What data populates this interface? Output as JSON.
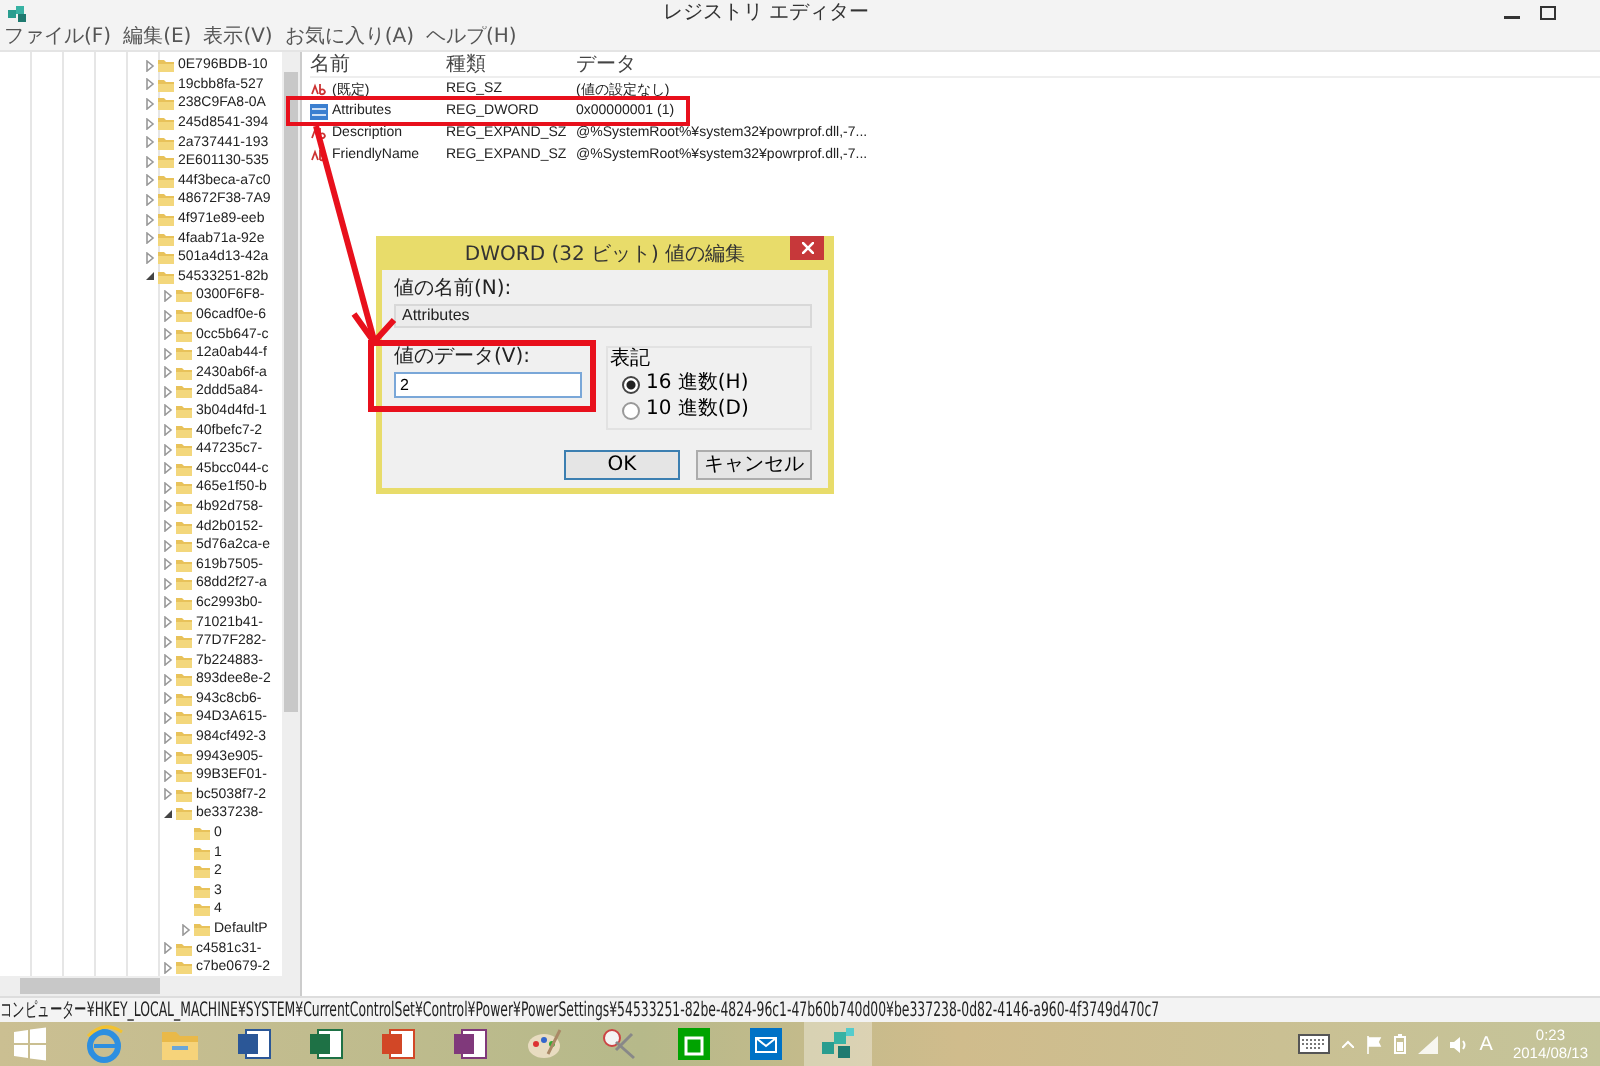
{
  "window": {
    "title": "レジストリ エディター"
  },
  "menu": [
    "ファイル(F)",
    "編集(E)",
    "表示(V)",
    "お気に入り(A)",
    "ヘルプ(H)"
  ],
  "tree": {
    "items": [
      {
        "label": "0E796BDB-10",
        "expanded": false
      },
      {
        "label": "19cbb8fa-527",
        "expanded": false
      },
      {
        "label": "238C9FA8-0A",
        "expanded": false
      },
      {
        "label": "245d8541-394",
        "expanded": false
      },
      {
        "label": "2a737441-193",
        "expanded": false
      },
      {
        "label": "2E601130-535",
        "expanded": false
      },
      {
        "label": "44f3beca-a7c0",
        "expanded": false
      },
      {
        "label": "48672F38-7A9",
        "expanded": false
      },
      {
        "label": "4f971e89-eeb",
        "expanded": false
      },
      {
        "label": "4faab71a-92e",
        "expanded": false
      },
      {
        "label": "501a4d13-42a",
        "expanded": false
      },
      {
        "label": "54533251-82b",
        "expanded": true,
        "children": [
          {
            "label": "0300F6F8-",
            "expanded": false
          },
          {
            "label": "06cadf0e-6",
            "expanded": false
          },
          {
            "label": "0cc5b647-c",
            "expanded": false
          },
          {
            "label": "12a0ab44-f",
            "expanded": false
          },
          {
            "label": "2430ab6f-a",
            "expanded": false
          },
          {
            "label": "2ddd5a84-",
            "expanded": false
          },
          {
            "label": "3b04d4fd-1",
            "expanded": false
          },
          {
            "label": "40fbefc7-2",
            "expanded": false
          },
          {
            "label": "447235c7-",
            "expanded": false
          },
          {
            "label": "45bcc044-c",
            "expanded": false
          },
          {
            "label": "465e1f50-b",
            "expanded": false
          },
          {
            "label": "4b92d758-",
            "expanded": false
          },
          {
            "label": "4d2b0152-",
            "expanded": false
          },
          {
            "label": "5d76a2ca-e",
            "expanded": false
          },
          {
            "label": "619b7505-",
            "expanded": false
          },
          {
            "label": "68dd2f27-a",
            "expanded": false
          },
          {
            "label": "6c2993b0-",
            "expanded": false
          },
          {
            "label": "71021b41-",
            "expanded": false
          },
          {
            "label": "77D7F282-",
            "expanded": false
          },
          {
            "label": "7b224883-",
            "expanded": false
          },
          {
            "label": "893dee8e-2",
            "expanded": false
          },
          {
            "label": "943c8cb6-",
            "expanded": false
          },
          {
            "label": "94D3A615-",
            "expanded": false
          },
          {
            "label": "984cf492-3",
            "expanded": false
          },
          {
            "label": "9943e905-",
            "expanded": false
          },
          {
            "label": "99B3EF01-",
            "expanded": false
          },
          {
            "label": "bc5038f7-2",
            "expanded": false
          },
          {
            "label": "be337238-",
            "expanded": true,
            "children": [
              {
                "label": "0"
              },
              {
                "label": "1"
              },
              {
                "label": "2"
              },
              {
                "label": "3"
              },
              {
                "label": "4"
              },
              {
                "label": "DefaultP",
                "expanded": false
              }
            ]
          },
          {
            "label": "c4581c31-",
            "expanded": false
          },
          {
            "label": "c7be0679-2",
            "expanded": false
          }
        ]
      }
    ]
  },
  "values": {
    "columns": [
      "名前",
      "種類",
      "データ"
    ],
    "rows": [
      {
        "kind": "string",
        "name": "(既定)",
        "type": "REG_SZ",
        "data": "(値の設定なし)"
      },
      {
        "kind": "dword",
        "name": "Attributes",
        "type": "REG_DWORD",
        "data": "0x00000001 (1)"
      },
      {
        "kind": "string",
        "name": "Description",
        "type": "REG_EXPAND_SZ",
        "data": "@%SystemRoot%¥system32¥powrprof.dll,-7..."
      },
      {
        "kind": "string",
        "name": "FriendlyName",
        "type": "REG_EXPAND_SZ",
        "data": "@%SystemRoot%¥system32¥powrprof.dll,-7..."
      }
    ]
  },
  "dialog": {
    "title": "DWORD (32 ビット) 値の編集",
    "name_label": "値の名前(N):",
    "name_value": "Attributes",
    "data_label": "値のデータ(V):",
    "data_value": "2",
    "base_label": "表記",
    "bases": [
      {
        "label": "16 進数(H)",
        "selected": true
      },
      {
        "label": "10 進数(D)",
        "selected": false
      }
    ],
    "buttons": [
      "OK",
      "キャンセル"
    ]
  },
  "status_bar": "コンピューター¥HKEY_LOCAL_MACHINE¥SYSTEM¥CurrentControlSet¥Control¥Power¥PowerSettings¥54533251-82be-4824-96c1-47b60b740d00¥be337238-0d82-4146-a960-4f3749d470c7",
  "taskbar": {
    "ime": "A",
    "time": "0:23",
    "date": "2014/08/13"
  }
}
